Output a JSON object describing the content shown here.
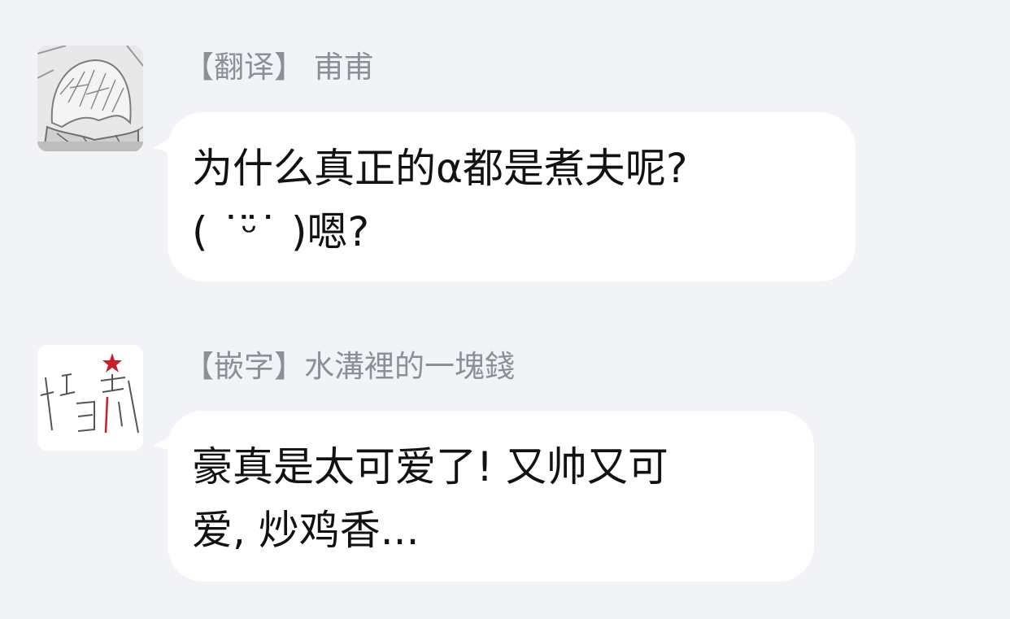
{
  "messages": [
    {
      "sender": "【翻译】 甫甫",
      "lines": [
        "为什么真正的α都是煮夫呢?",
        "( ˙ᵕ̈˙ )嗯?"
      ],
      "avatar": "manga-boy-avatar"
    },
    {
      "sender": "【嵌字】水溝裡的一塊錢",
      "lines": [
        "豪真是太可爱了! 又帅又可",
        "爱, 炒鸡香..."
      ],
      "avatar": "handwritten-character-avatar"
    }
  ],
  "colors": {
    "background": "#f2f3f7",
    "bubble": "#ffffff",
    "sender_text": "#8b8f98",
    "message_text": "#121212",
    "star": "#c8202a"
  }
}
